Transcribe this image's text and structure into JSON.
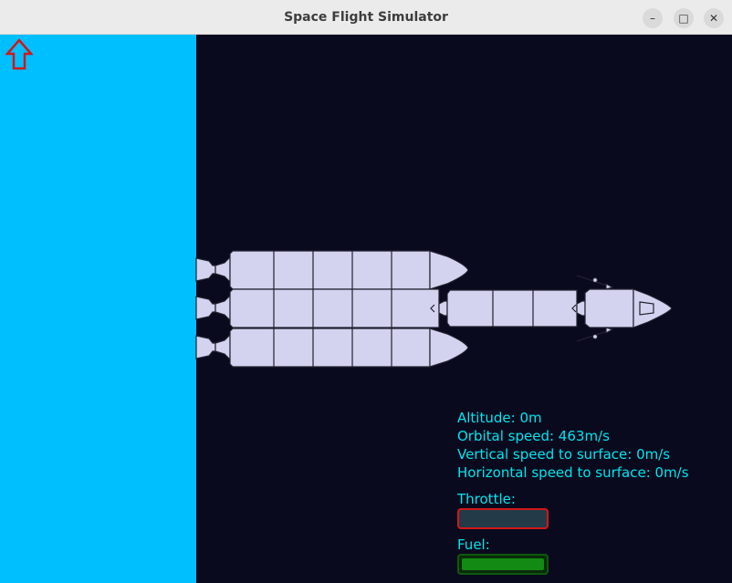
{
  "window": {
    "title": "Space Flight Simulator",
    "minimize_icon": "minimize-icon",
    "maximize_icon": "maximize-icon",
    "close_icon": "close-icon"
  },
  "colors": {
    "ground": "#00bfff",
    "space": "#0a0a1e",
    "rocket_fill": "#d3d3f0",
    "hud_text": "#00e5ee",
    "throttle_border": "#d01818",
    "fuel_fill": "#138a13",
    "arrow": "#d01818"
  },
  "controls": {
    "up_arrow_icon": "up-arrow-icon"
  },
  "hud": {
    "altitude": "Altitude: 0m",
    "orbital_speed": "Orbital speed: 463m/s",
    "vertical_speed": "Vertical speed to surface: 0m/s",
    "horizontal_speed": "Horizontal speed to surface: 0m/s"
  },
  "throttle": {
    "label": "Throttle:",
    "level": 0
  },
  "fuel": {
    "label": "Fuel:",
    "level": 1.0
  }
}
